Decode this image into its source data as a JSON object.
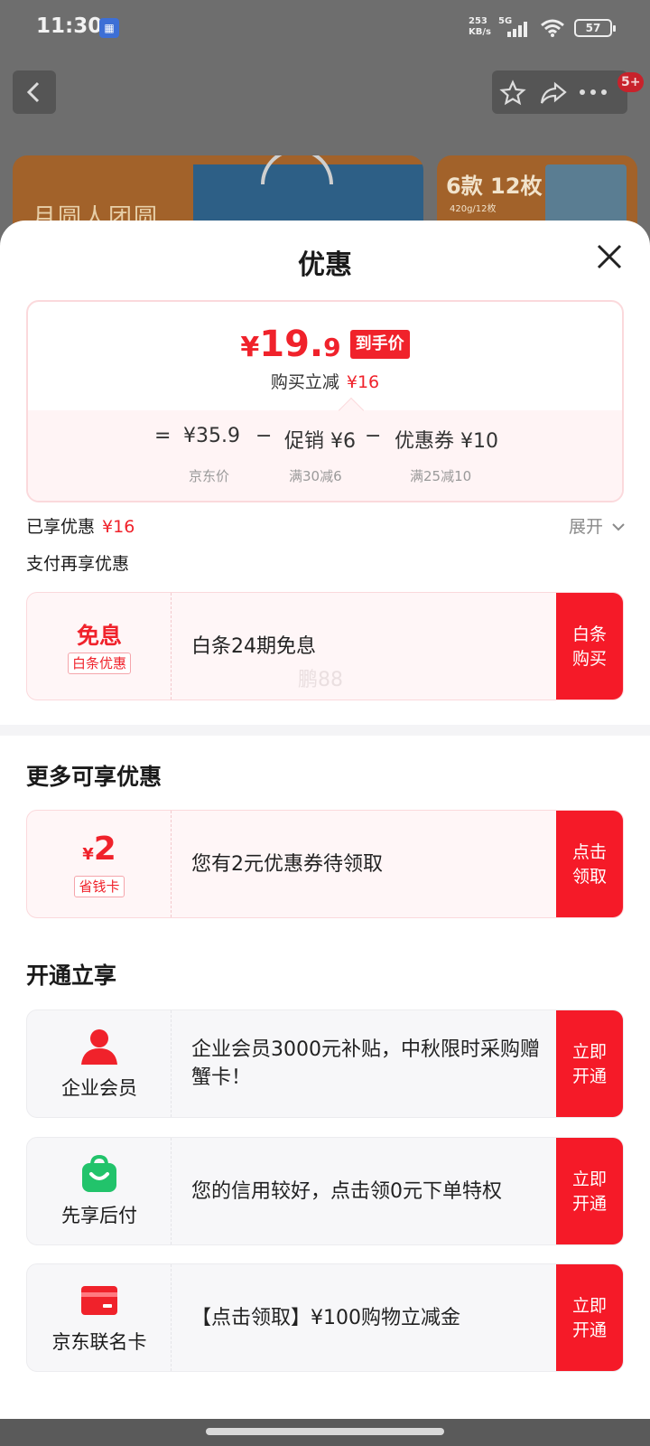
{
  "status_bar": {
    "time": "11:30",
    "net_speed_value": "253",
    "net_speed_unit": "KB/s",
    "network_type": "5G",
    "battery": "57"
  },
  "background": {
    "badge": "5+",
    "banner_left_text": "月圆人团圆",
    "banner_right_text": "6款 12枚",
    "banner_right_sub": "420g/12枚"
  },
  "sheet": {
    "title": "优惠",
    "price": {
      "yen": "¥",
      "integer": "19.",
      "decimal": "9",
      "tag": "到手价",
      "reduce_label": "购买立减",
      "reduce_value": "¥16"
    },
    "calc": {
      "equals": "=",
      "jd_price": "¥35.9",
      "minus1": "−",
      "promo": "促销 ¥6",
      "minus2": "−",
      "coupon": "优惠券 ¥10",
      "jd_price_label": "京东价",
      "promo_label": "满30减6",
      "coupon_label": "满25减10"
    },
    "enjoyed_label": "已享优惠",
    "enjoyed_value": "¥16",
    "expand_label": "展开",
    "pay_more_label": "支付再享优惠",
    "baitiao_card": {
      "title": "免息",
      "tag": "白条优惠",
      "text": "白条24期免息",
      "watermark": "鹏88",
      "button": "白条购买"
    },
    "more_title": "更多可享优惠",
    "coupon_card": {
      "yen": "¥",
      "amount": "2",
      "tag": "省钱卡",
      "text": "您有2元优惠券待领取",
      "button": "点击领取"
    },
    "open_title": "开通立享",
    "member_cards": [
      {
        "name": "企业会员",
        "icon": "person-icon",
        "text": "企业会员3000元补贴，中秋限时采购赠蟹卡！",
        "button": "立即开通",
        "icon_color": "#f0222b"
      },
      {
        "name": "先享后付",
        "icon": "shopping-bag-icon",
        "text": "您的信用较好，点击领0元下单特权",
        "button": "立即开通",
        "icon_color": "#22c36b"
      },
      {
        "name": "京东联名卡",
        "icon": "credit-card-icon",
        "text": "【点击领取】¥100购物立减金",
        "button": "立即开通",
        "icon_color": "#f0222b"
      }
    ]
  }
}
